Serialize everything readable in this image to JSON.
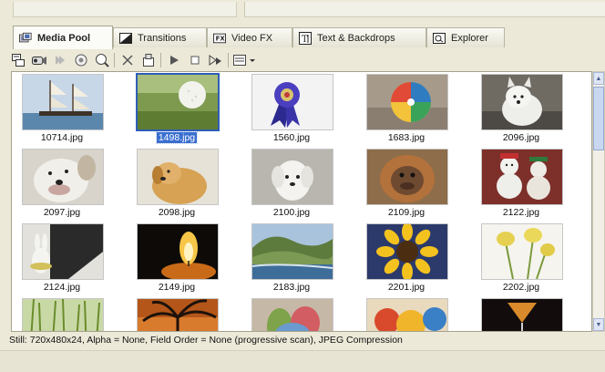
{
  "tabs": [
    {
      "label": "Media Pool",
      "icon": "media-pool-icon",
      "active": true
    },
    {
      "label": "Transitions",
      "icon": "transitions-icon",
      "active": false
    },
    {
      "label": "Video FX",
      "icon": "video-fx-icon",
      "active": false
    },
    {
      "label": "Text & Backdrops",
      "icon": "text-backdrops-icon",
      "active": false
    },
    {
      "label": "Explorer",
      "icon": "explorer-icon",
      "active": false
    }
  ],
  "toolbar": {
    "buttons": [
      "import-media-icon",
      "capture-video-icon",
      "get-media-icon",
      "search-icon",
      "media-properties-icon",
      "remove-icon",
      "media-fx-icon",
      "play-icon",
      "stop-icon",
      "auto-preview-icon",
      "views-icon"
    ]
  },
  "media": {
    "items": [
      {
        "label": "10714.jpg",
        "selected": false
      },
      {
        "label": "1498.jpg",
        "selected": true
      },
      {
        "label": "1560.jpg",
        "selected": false
      },
      {
        "label": "1683.jpg",
        "selected": false
      },
      {
        "label": "2096.jpg",
        "selected": false
      },
      {
        "label": "2097.jpg",
        "selected": false
      },
      {
        "label": "2098.jpg",
        "selected": false
      },
      {
        "label": "2100.jpg",
        "selected": false
      },
      {
        "label": "2109.jpg",
        "selected": false
      },
      {
        "label": "2122.jpg",
        "selected": false
      },
      {
        "label": "2124.jpg",
        "selected": false
      },
      {
        "label": "2149.jpg",
        "selected": false
      },
      {
        "label": "2183.jpg",
        "selected": false
      },
      {
        "label": "2201.jpg",
        "selected": false
      },
      {
        "label": "2202.jpg",
        "selected": false
      }
    ],
    "partial_row": 5
  },
  "status": {
    "text": "Still: 720x480x24, Alpha = None, Field Order = None (progressive scan), JPEG Compression"
  }
}
